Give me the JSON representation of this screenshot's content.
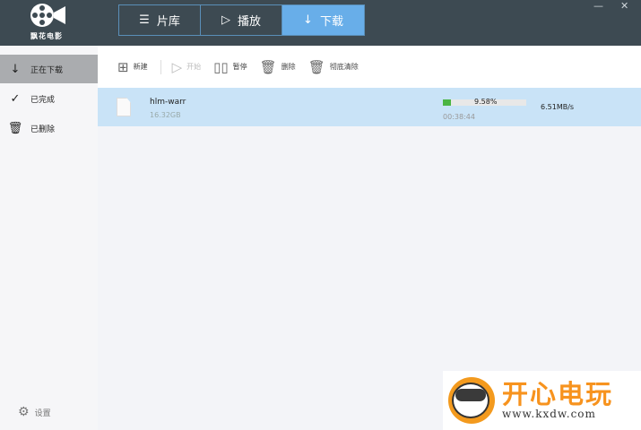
{
  "app": {
    "logo_text": "飘花电影"
  },
  "tabs": [
    {
      "icon": "☰",
      "label": "片库"
    },
    {
      "icon": "▷",
      "label": "播放"
    },
    {
      "icon": "↓",
      "label": "下载"
    }
  ],
  "window": {
    "minimize": "—",
    "close": "✕"
  },
  "sidebar": {
    "items": [
      {
        "icon": "↓",
        "label": "正在下载"
      },
      {
        "icon": "✓",
        "label": "已完成"
      },
      {
        "icon": "🗑",
        "label": "已删除"
      }
    ],
    "settings": "设置"
  },
  "toolbar": {
    "new": "新建",
    "start": "开始",
    "pause": "暂停",
    "delete": "删除",
    "purge": "彻底清除"
  },
  "downloads": [
    {
      "name": "hlm-warr",
      "size": "16.32GB",
      "progress_percent": 9.58,
      "progress_text": "9.58%",
      "eta": "00:38:44",
      "speed": "6.51MB/s"
    }
  ],
  "ad": {
    "title": "开心电玩",
    "url": "www.kxdw.com"
  }
}
